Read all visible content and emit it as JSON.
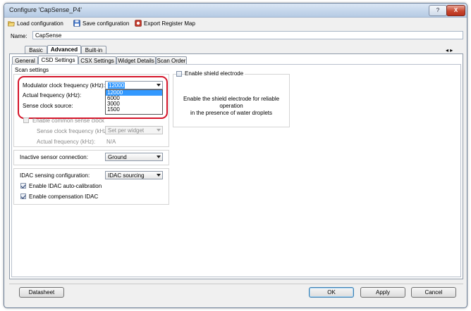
{
  "window": {
    "title": "Configure 'CapSense_P4'",
    "controls": {
      "help": "?",
      "close": "X"
    }
  },
  "toolbar": {
    "load": "Load configuration",
    "save": "Save configuration",
    "export": "Export Register Map"
  },
  "name_field": {
    "label": "Name:",
    "value": "CapSense"
  },
  "top_tabs": [
    {
      "label": "Basic"
    },
    {
      "label": "Advanced"
    },
    {
      "label": "Built-in"
    }
  ],
  "scroll_arrows": "◂ ▸",
  "sub_tabs": [
    {
      "label": "General"
    },
    {
      "label": "CSD Settings"
    },
    {
      "label": "CSX Settings"
    },
    {
      "label": "Widget Details"
    },
    {
      "label": "Scan Order"
    }
  ],
  "scan_settings": {
    "title": "Scan settings",
    "modulator_clock_label": "Modulator clock frequency (kHz):",
    "modulator_clock_value": "12000",
    "actual_frequency_label": "Actual frequency (kHz):",
    "sense_clock_source_label": "Sense clock source:",
    "dropdown_options": [
      "12000",
      "6000",
      "3000",
      "1500"
    ],
    "enable_common_sense_clock": "Enable common sense clock",
    "sense_clock_freq_label": "Sense clock frequency (kHz):",
    "sense_clock_freq_value": "Set per widget",
    "actual_frequency2_label": "Actual frequency (kHz):",
    "actual_frequency2_value": "N/A"
  },
  "inactive_sensor": {
    "label": "Inactive sensor connection:",
    "value": "Ground"
  },
  "idac": {
    "label": "IDAC sensing configuration:",
    "value": "IDAC sourcing",
    "auto_calibration": "Enable IDAC auto-calibration",
    "auto_calibration_checked": true,
    "compensation": "Enable compensation IDAC",
    "compensation_checked": true
  },
  "shield": {
    "checkbox_label": "Enable shield electrode",
    "description_line1": "Enable the shield electrode for reliable operation",
    "description_line2": "in the presence of water droplets"
  },
  "buttons": {
    "datasheet": "Datasheet",
    "ok": "OK",
    "apply": "Apply",
    "cancel": "Cancel"
  },
  "colors": {
    "highlight_ring": "#d4152a",
    "selection": "#3399ff",
    "titlebar": "#c3d5ea"
  }
}
